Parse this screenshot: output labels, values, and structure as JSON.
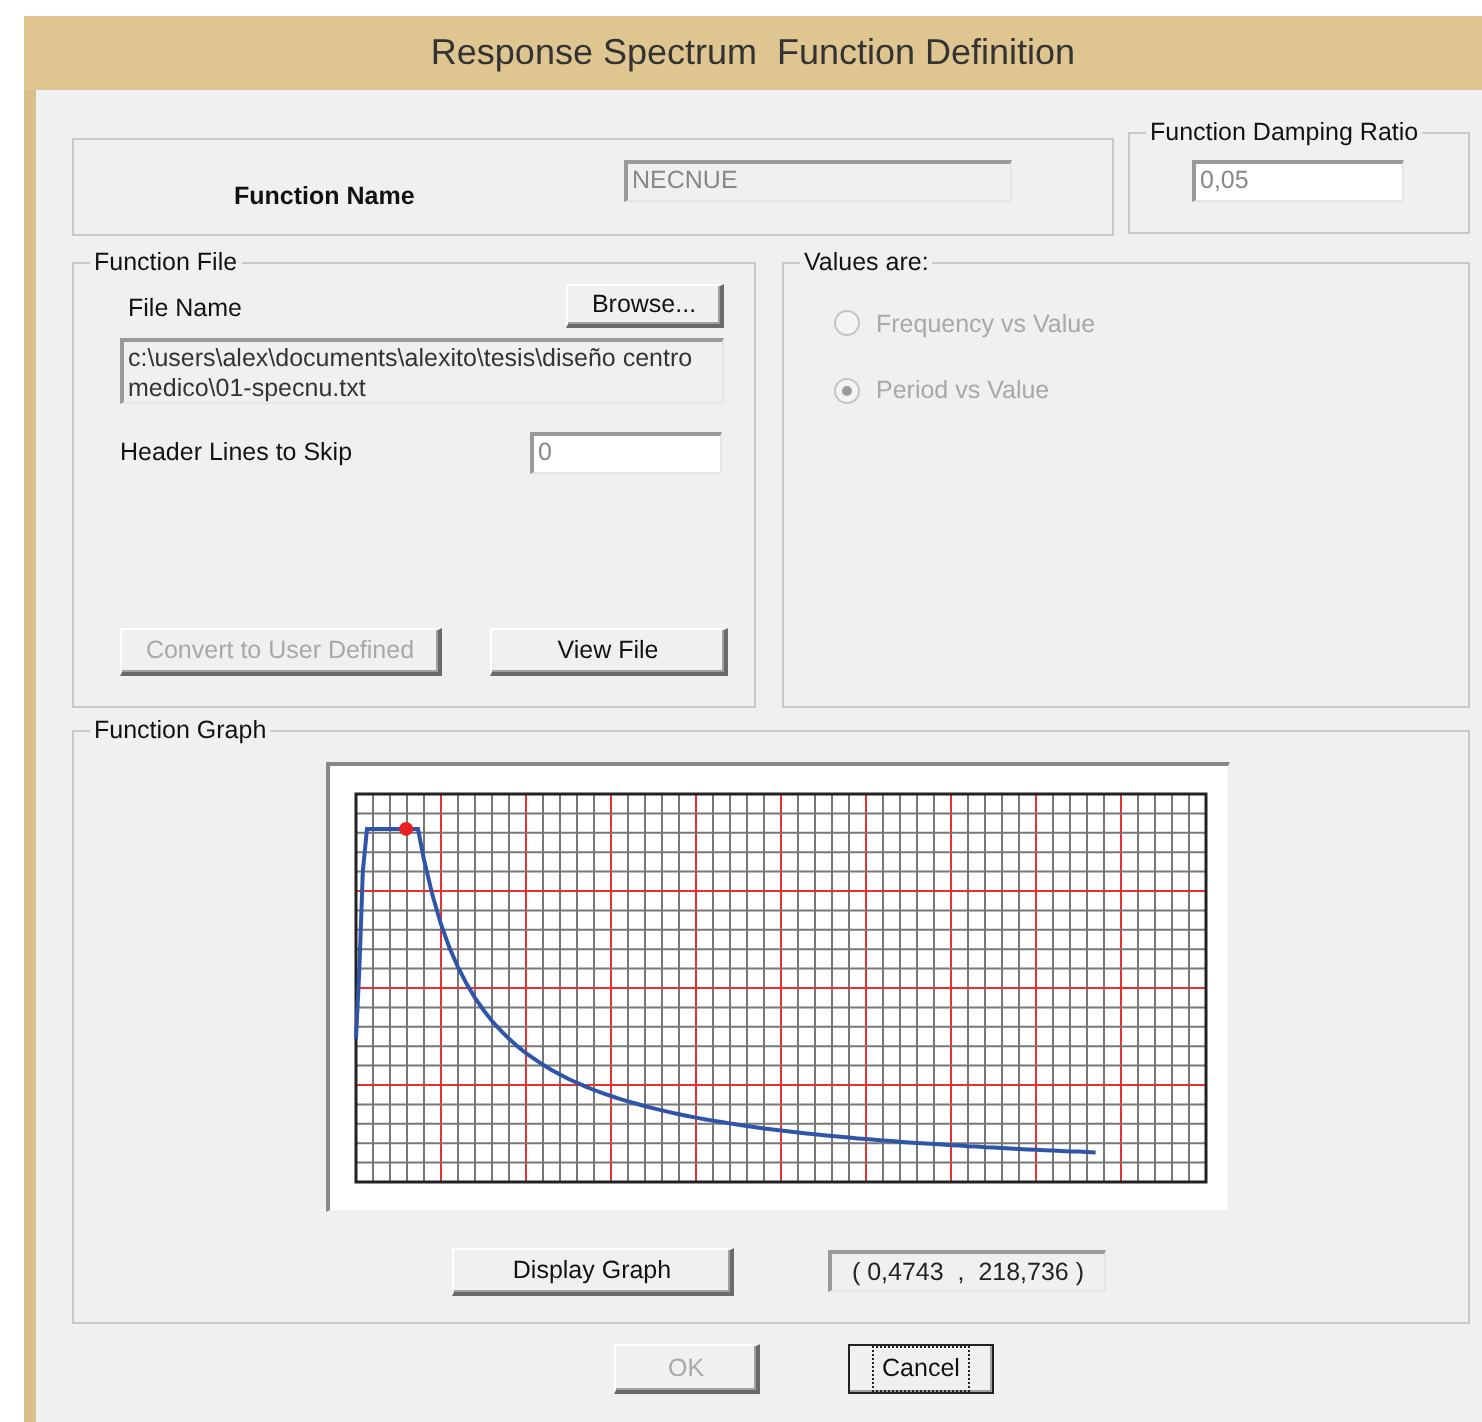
{
  "window": {
    "title": "Response Spectrum  Function Definition"
  },
  "function_name": {
    "label": "Function Name",
    "value": "NECNUE",
    "disabled": true
  },
  "damping": {
    "title": "Function Damping Ratio",
    "value": "0,05"
  },
  "function_file": {
    "title": "Function File",
    "file_name_label": "File Name",
    "browse_button": "Browse...",
    "file_path": "c:\\users\\alex\\documents\\alexito\\tesis\\diseño centro medico\\01-specnu.txt",
    "header_lines_label": "Header Lines to Skip",
    "header_lines_value": "0",
    "buttons": [
      {
        "label": "Convert to User Defined",
        "disabled": true
      },
      {
        "label": "View File",
        "disabled": false
      }
    ]
  },
  "values_are": {
    "title": "Values are:",
    "options": [
      {
        "label": "Frequency vs Value",
        "selected": false,
        "disabled": true
      },
      {
        "label": "Period vs Value",
        "selected": true,
        "disabled": true
      }
    ]
  },
  "function_graph": {
    "title": "Function Graph",
    "display_button": "Display Graph",
    "readout": "( 0,4743  ,  218,736 )"
  },
  "buttons": [
    {
      "label": "OK",
      "disabled": true,
      "focused": false
    },
    {
      "label": "Cancel",
      "disabled": false,
      "focused": true
    }
  ]
}
